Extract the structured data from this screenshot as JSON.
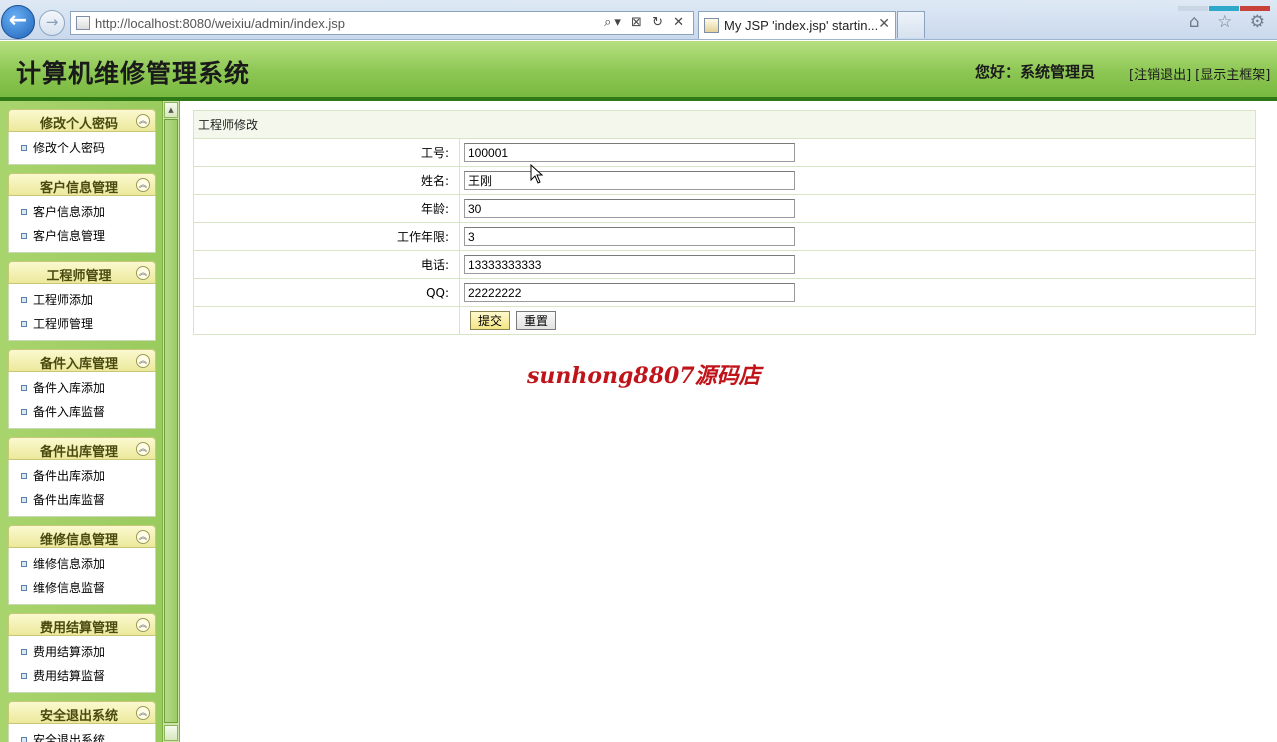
{
  "browser": {
    "url": "http://localhost:8080/weixiu/admin/index.jsp",
    "tab_title": "My JSP 'index.jsp' startin...",
    "tab_close": "✕",
    "back_icon": "←",
    "forward_icon": "→",
    "address_buttons": "⌕▾ ⊠ ↻ ✕",
    "right_icons": "⌂ ☆ ⚙"
  },
  "header": {
    "title": "计算机维修管理系统",
    "greeting": "您好：系统管理员",
    "logout_link": "[注销退出]",
    "show_frame_link": "[显示主框架]"
  },
  "sidebar": {
    "groups": [
      {
        "title": "修改个人密码",
        "items": [
          "修改个人密码"
        ]
      },
      {
        "title": "客户信息管理",
        "items": [
          "客户信息添加",
          "客户信息管理"
        ]
      },
      {
        "title": "工程师管理",
        "items": [
          "工程师添加",
          "工程师管理"
        ]
      },
      {
        "title": "备件入库管理",
        "items": [
          "备件入库添加",
          "备件入库监督"
        ]
      },
      {
        "title": "备件出库管理",
        "items": [
          "备件出库添加",
          "备件出库监督"
        ]
      },
      {
        "title": "维修信息管理",
        "items": [
          "维修信息添加",
          "维修信息监督"
        ]
      },
      {
        "title": "费用结算管理",
        "items": [
          "费用结算添加",
          "费用结算监督"
        ]
      },
      {
        "title": "安全退出系统",
        "items": [
          "安全退出系统"
        ]
      }
    ],
    "collapse_icon": "︽"
  },
  "form": {
    "caption": "工程师修改",
    "fields": [
      {
        "label": "工号:",
        "value": "100001"
      },
      {
        "label": "姓名:",
        "value": "王刚"
      },
      {
        "label": "年龄:",
        "value": "30"
      },
      {
        "label": "工作年限:",
        "value": "3"
      },
      {
        "label": "电话:",
        "value": "13333333333"
      },
      {
        "label": "QQ:",
        "value": "22222222"
      }
    ],
    "submit_label": "提交",
    "reset_label": "重置"
  },
  "watermark": "sunhong8807源码店",
  "colors": {
    "header_green": "#8cc653",
    "header_line": "#2f7a16",
    "watermark_red": "#c0141a",
    "window_close": "#c8423a",
    "window_accent": "#2fa9c9"
  }
}
